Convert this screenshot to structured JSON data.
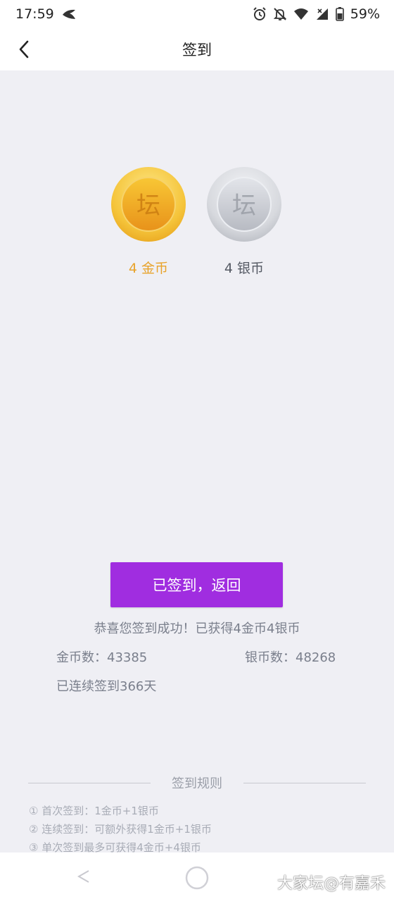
{
  "status_bar": {
    "time": "17:59",
    "battery": "59%"
  },
  "nav": {
    "title": "签到"
  },
  "coins": {
    "gold_label": "4 金币",
    "silver_label": "4 银币",
    "gold_color": "#e8a32b",
    "silver_color": "#c0c4cc"
  },
  "main": {
    "button_label": "已签到，返回",
    "button_color": "#a02de0",
    "success_message": "恭喜您签到成功！已获得4金币4银币",
    "gold_count": "金币数：43385",
    "silver_count": "银币数：48268",
    "streak": "已连续签到366天"
  },
  "rules": {
    "title": "签到规则",
    "items": [
      "① 首次签到：1金币+1银币",
      "② 连续签到：可额外获得1金币+1银币",
      "③ 单次签到最多可获得4金币+4银币"
    ]
  },
  "watermark": "大家坛@有嘉禾"
}
